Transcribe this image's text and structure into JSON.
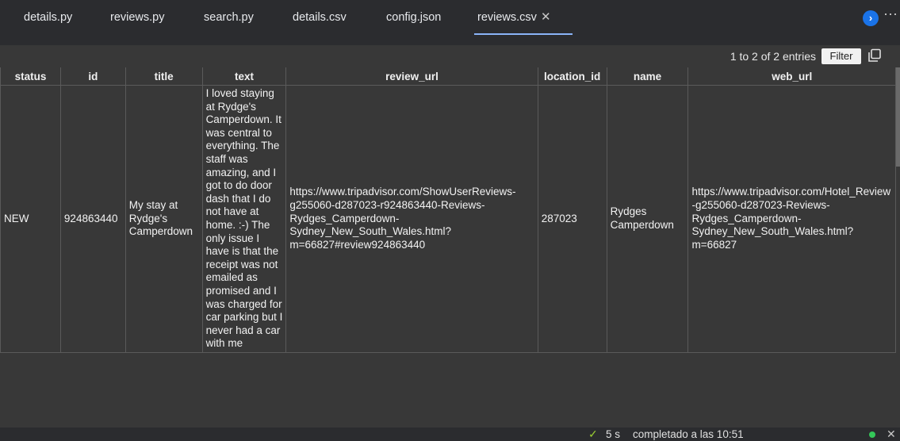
{
  "tabs": [
    {
      "label": "details.py"
    },
    {
      "label": "reviews.py"
    },
    {
      "label": "search.py"
    },
    {
      "label": "details.csv"
    },
    {
      "label": "config.json"
    },
    {
      "label": "reviews.csv",
      "close": "✕"
    }
  ],
  "toolbar": {
    "entries_text": "1 to 2 of 2 entries",
    "filter_label": "Filter"
  },
  "table": {
    "headers": [
      "status",
      "id",
      "title",
      "text",
      "review_url",
      "location_id",
      "name",
      "web_url"
    ],
    "rows": [
      {
        "status": "NEW",
        "id": "924863440",
        "title": "My stay at Rydge's Camperdown",
        "text": "I loved staying at Rydge's Camperdown. It was central to everything. The staff was amazing, and I got to do door dash that I do not have at home. :-) The only issue I have is that the receipt was not emailed as promised and I was charged for car parking but I never had a car with me",
        "review_url": "https://www.tripadvisor.com/ShowUserReviews-g255060-d287023-r924863440-Reviews-Rydges_Camperdown-Sydney_New_South_Wales.html?m=66827#review924863440",
        "location_id": "287023",
        "name": "Rydges Camperdown",
        "web_url": "https://www.tripadvisor.com/Hotel_Review-g255060-d287023-Reviews-Rydges_Camperdown-Sydney_New_South_Wales.html?m=66827"
      }
    ]
  },
  "statusbar": {
    "time": "5 s",
    "message": "completado a las 10:51"
  },
  "colors": {
    "accent": "#8ab4f8",
    "run_button": "#1a73e8",
    "status_ok": "#34c759"
  }
}
